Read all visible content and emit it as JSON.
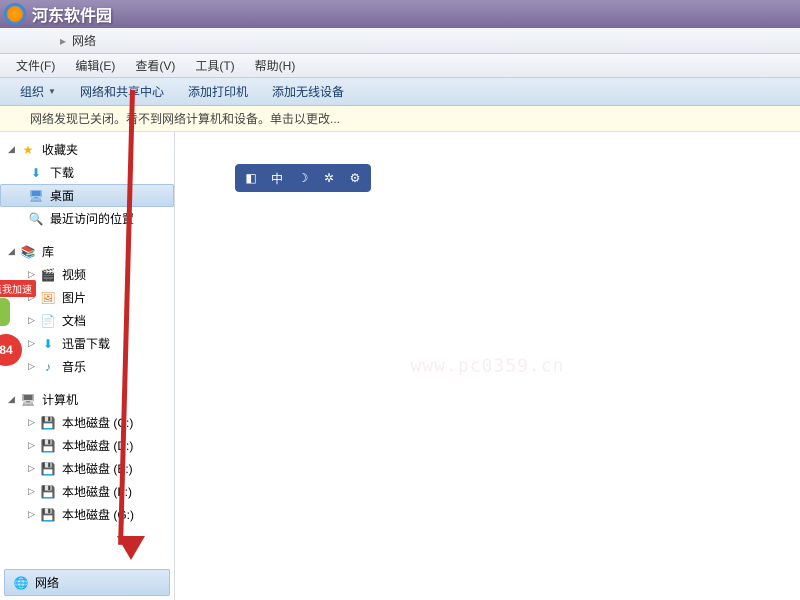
{
  "watermark": {
    "logo_text": "河东软件园",
    "url": "www.pc0359.cn"
  },
  "breadcrumb": {
    "arrow": "▸",
    "current": "网络"
  },
  "menu": {
    "file": "文件(F)",
    "edit": "编辑(E)",
    "view": "查看(V)",
    "tools": "工具(T)",
    "help": "帮助(H)"
  },
  "toolbar": {
    "organize": "组织",
    "network_center": "网络和共享中心",
    "add_printer": "添加打印机",
    "add_wireless": "添加无线设备"
  },
  "infobar": {
    "message": "网络发现已关闭。看不到网络计算机和设备。单击以更改..."
  },
  "sidebar": {
    "favorites": {
      "label": "收藏夹",
      "items": {
        "downloads": "下载",
        "desktop": "桌面",
        "recent": "最近访问的位置"
      }
    },
    "libraries": {
      "label": "库",
      "items": {
        "videos": "视频",
        "pictures": "图片",
        "documents": "文档",
        "xunlei": "迅雷下载",
        "music": "音乐"
      }
    },
    "computer": {
      "label": "计算机",
      "disks": {
        "c": "本地磁盘 (C:)",
        "d": "本地磁盘 (D:)",
        "e": "本地磁盘 (E:)",
        "f": "本地磁盘 (F:)",
        "g": "本地磁盘 (G:)"
      }
    },
    "network": {
      "label": "网络"
    }
  },
  "side_badge": {
    "accel": "点我加速",
    "count": "84"
  },
  "preview_icons": {
    "a": "◧",
    "b": "中",
    "c": "☽",
    "d": "✲",
    "e": "⚙"
  },
  "icons": {
    "caret_open": "◢",
    "caret_closed": "▷"
  }
}
